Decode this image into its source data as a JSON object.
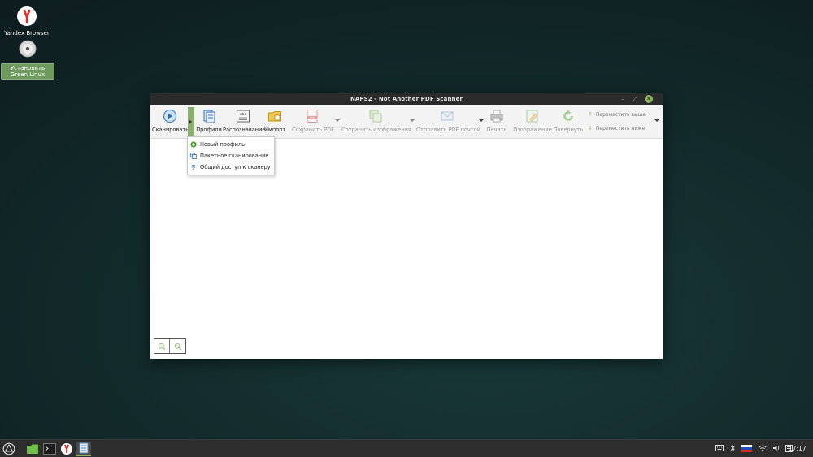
{
  "desktop": {
    "icons": [
      {
        "label": "Yandex Browser"
      },
      {
        "label": "Установить Green Linux"
      }
    ]
  },
  "window": {
    "title": "NAPS2 - Not Another PDF Scanner",
    "controls": {
      "minimize": "–",
      "maximize": "⤢",
      "close": "✕"
    }
  },
  "toolbar": {
    "scan": "Сканировать",
    "profiles": "Профили",
    "ocr": "Распознавание",
    "import": "Импорт",
    "save_pdf": "Сохранить PDF",
    "save_images": "Сохранить изображения",
    "email_pdf": "Отправить PDF почтой",
    "print": "Печать",
    "image": "Изображение",
    "rotate": "Повернуть",
    "move_up": "Переместить выше",
    "move_down": "Переместить ниже"
  },
  "menu": {
    "items": [
      {
        "label": "Новый профиль"
      },
      {
        "label": "Пакетное сканирование"
      },
      {
        "label": "Общий доступ к сканеру"
      }
    ]
  },
  "taskbar": {
    "clock": "17:17"
  },
  "colors": {
    "accent": "#8fb561",
    "titlebar": "#2b2b2b",
    "taskbar": "#2d2d2d"
  }
}
